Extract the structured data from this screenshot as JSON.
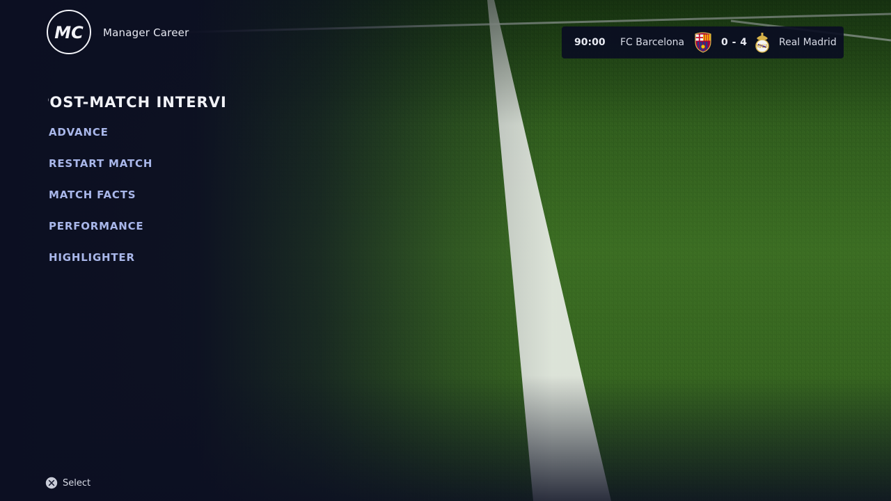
{
  "header": {
    "logo_text": "MC",
    "title": "Manager Career"
  },
  "scoreboard": {
    "clock": "90:00",
    "home_team": "FC Barcelona",
    "score": "0 - 4",
    "away_team": "Real Madrid",
    "home_crest_icon": "fc-barcelona-crest-icon",
    "away_crest_icon": "real-madrid-crest-icon"
  },
  "menu": {
    "heading": "OST-MATCH INTERVI",
    "items": [
      {
        "label": "ADVANCE"
      },
      {
        "label": "RESTART MATCH"
      },
      {
        "label": "MATCH FACTS"
      },
      {
        "label": "PERFORMANCE"
      },
      {
        "label": "HIGHLIGHTER"
      }
    ]
  },
  "footer": {
    "button_icon": "cross-button-icon",
    "hint": "Select"
  },
  "colors": {
    "navy": "#0c0f22",
    "grass": "#3a6a22",
    "menu_item": "#a9b7ea",
    "heading": "#f1f2f7",
    "barca_blue": "#1d3a8c",
    "barca_red": "#a5003a",
    "madrid_gold": "#d9b44a"
  }
}
